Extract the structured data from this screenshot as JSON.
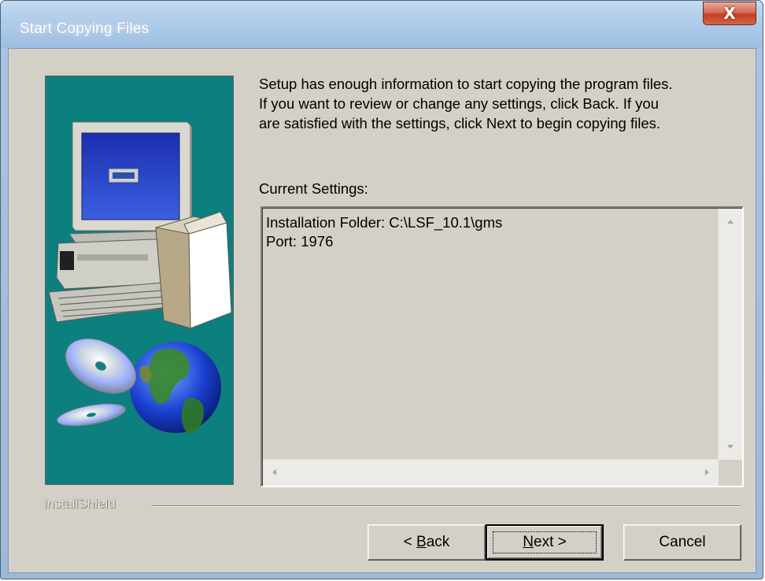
{
  "window": {
    "title": "Start Copying Files",
    "close_glyph": "X"
  },
  "intro_text": "Setup has enough information to start copying the program files.\nIf you want to review or change any settings, click Back.  If you\nare satisfied with the settings, click Next to begin copying files.",
  "settings": {
    "label": "Current Settings:",
    "lines": [
      "Installation Folder: C:\\LSF_10.1\\gms",
      "Port: 1976"
    ]
  },
  "brand": "InstallShield",
  "buttons": {
    "back": {
      "prefix": "< ",
      "mnemonic": "B",
      "rest": "ack"
    },
    "next": {
      "mnemonic": "N",
      "rest": "ext >"
    },
    "cancel": "Cancel"
  },
  "colors": {
    "panel_teal": "#0c7f7f",
    "dialog_face": "#d4d0c8",
    "close_red": "#c2411f"
  },
  "icons": [
    "computer-icon",
    "cd-disc-icon",
    "globe-icon",
    "close-icon"
  ]
}
